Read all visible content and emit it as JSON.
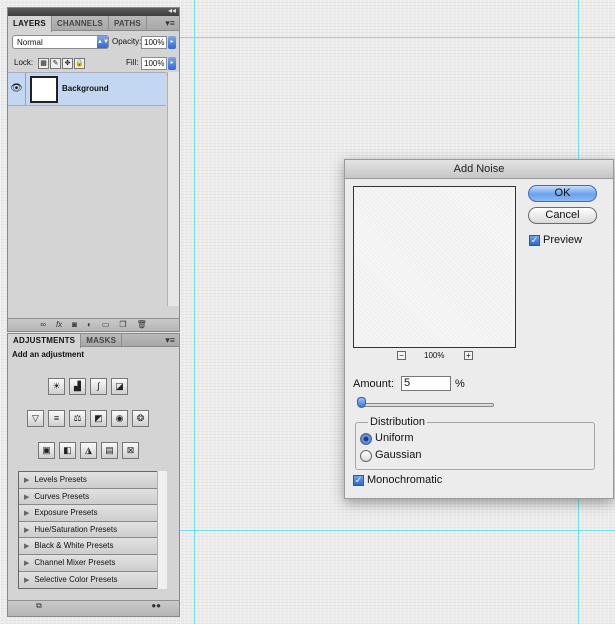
{
  "layers_panel": {
    "tabs": [
      "LAYERS",
      "CHANNELS",
      "PATHS"
    ],
    "menu_icon": "panel-menu-icon",
    "blend_mode": "Normal",
    "opacity_label": "Opacity:",
    "opacity_value": "100%",
    "lock_label": "Lock:",
    "fill_label": "Fill:",
    "fill_value": "100%",
    "layer_name": "Background"
  },
  "adjustments_panel": {
    "tabs": [
      "ADJUSTMENTS",
      "MASKS"
    ],
    "heading": "Add an adjustment",
    "presets": [
      "Levels Presets",
      "Curves Presets",
      "Exposure Presets",
      "Hue/Saturation Presets",
      "Black & White Presets",
      "Channel Mixer Presets",
      "Selective Color Presets"
    ]
  },
  "dialog": {
    "title": "Add Noise",
    "ok_label": "OK",
    "cancel_label": "Cancel",
    "preview_label": "Preview",
    "preview_checked": true,
    "zoom_minus": "−",
    "zoom_label": "100%",
    "zoom_plus": "+",
    "amount_label": "Amount:",
    "amount_value": "5",
    "percent": "%",
    "slider_value_fraction": 0.01,
    "distribution_label": "Distribution",
    "uniform_label": "Uniform",
    "gaussian_label": "Gaussian",
    "selected_distribution": "Uniform",
    "monochromatic_label": "Monochromatic",
    "monochromatic_checked": true
  }
}
